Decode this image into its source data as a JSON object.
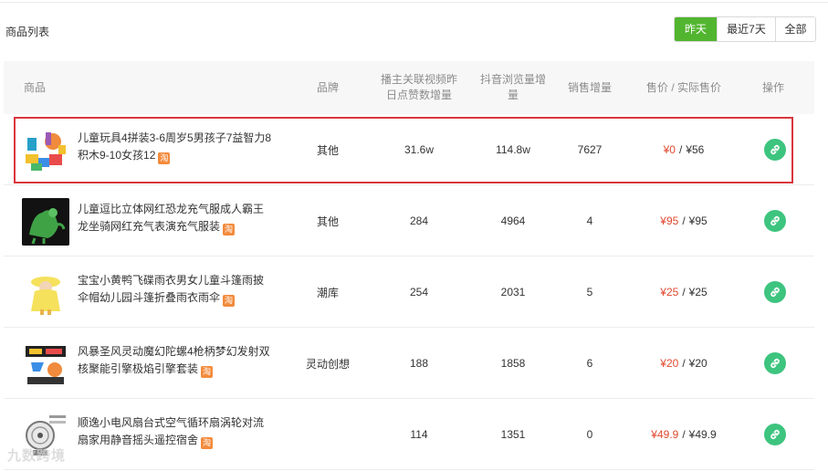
{
  "section_title": "商品列表",
  "range": {
    "options": [
      "昨天",
      "最近7天",
      "全部"
    ],
    "selected": "昨天"
  },
  "colors": {
    "accent": "#52b52f",
    "price_red": "#e0492f",
    "link_green": "#3dc47e",
    "highlight": "#d9363e",
    "tao_orange": "#f38b3c"
  },
  "columns": {
    "product": "商品",
    "brand": "品牌",
    "video_likes": "播主关联视频昨日点赞数增量",
    "views": "抖音浏览量增量",
    "sales": "销售增量",
    "price": "售价 / 实际售价",
    "action": "操作"
  },
  "tao_badge": "淘",
  "currency": "¥",
  "rows": [
    {
      "name": "儿童玩具4拼装3-6周岁5男孩子7益智力8积木9-10女孩12",
      "brand": "其他",
      "video_likes": "31.6w",
      "views": "114.8w",
      "sales": "7627",
      "price": "¥0",
      "actual_price": "¥56",
      "thumb_icon": "toy-blocks-icon"
    },
    {
      "name": "儿童逗比立体网红恐龙充气服成人霸王龙坐骑网红充气表演充气服装",
      "brand": "其他",
      "video_likes": "284",
      "views": "4964",
      "sales": "4",
      "price": "¥95",
      "actual_price": "¥95",
      "thumb_icon": "dinosaur-costume-icon"
    },
    {
      "name": "宝宝小黄鸭飞碟雨衣男女儿童斗篷雨披伞帽幼儿园斗篷折叠雨衣雨伞",
      "brand": "潮库",
      "video_likes": "254",
      "views": "2031",
      "sales": "5",
      "price": "¥25",
      "actual_price": "¥25",
      "thumb_icon": "raincoat-icon"
    },
    {
      "name": "风暴圣风灵动魔幻陀螺4枪柄梦幻发射双核聚能引擎极焰引擎套装",
      "brand": "灵动创想",
      "video_likes": "188",
      "views": "1858",
      "sales": "6",
      "price": "¥20",
      "actual_price": "¥20",
      "thumb_icon": "spinning-top-icon"
    },
    {
      "name": "顺逸小电风扇台式空气循环扇涡轮对流扇家用静音摇头遥控宿舍",
      "brand": "",
      "video_likes": "114",
      "views": "1351",
      "sales": "0",
      "price": "¥49.9",
      "actual_price": "¥49.9",
      "thumb_icon": "desk-fan-icon"
    }
  ],
  "watermark": "九数跨境"
}
